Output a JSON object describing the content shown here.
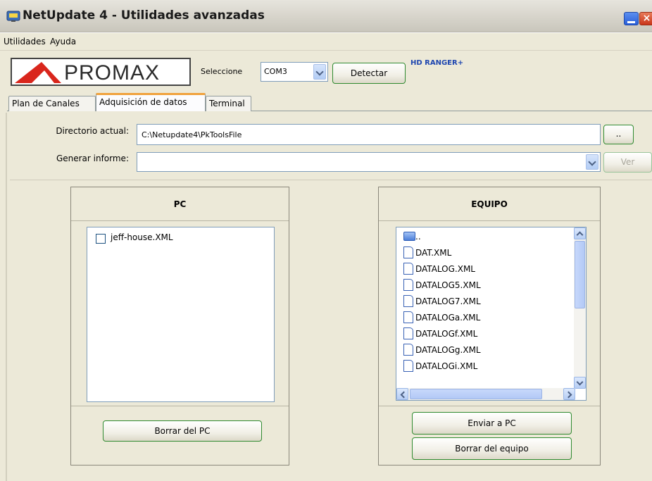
{
  "window": {
    "title": "NetUpdate 4 - Utilidades avanzadas",
    "close_glyph": "×"
  },
  "menu": {
    "items": [
      "Utilidades",
      "Ayuda"
    ]
  },
  "toolbar": {
    "logo_text": "PROMAX",
    "port_label": "Seleccione",
    "port_value": "COM3",
    "detect_label": "Detectar",
    "device_name": "HD RANGER+"
  },
  "tabs": [
    {
      "label": "Plan de Canales",
      "active": false
    },
    {
      "label": "Adquisición de datos",
      "active": true
    },
    {
      "label": "Terminal",
      "active": false
    }
  ],
  "form": {
    "directory_label": "Directorio actual:",
    "directory_value": "C:\\Netupdate4\\PkToolsFile",
    "browse_label": "..",
    "report_label": "Generar informe:",
    "report_value": "",
    "view_label": "Ver"
  },
  "pc_panel": {
    "title": "PC",
    "files": [
      {
        "name": "jeff-house.XML",
        "checked": false
      }
    ],
    "delete_label": "Borrar del PC"
  },
  "equipment_panel": {
    "title": "EQUIPO",
    "files": [
      "..",
      "DAT.XML",
      "DATALOG.XML",
      "DATALOG5.XML",
      "DATALOG7.XML",
      "DATALOGa.XML",
      "DATALOGf.XML",
      "DATALOGg.XML",
      "DATALOGi.XML"
    ],
    "send_label": "Enviar a PC",
    "delete_label": "Borrar del equipo"
  },
  "colors": {
    "accent_tab": "#f0a23c",
    "button_border": "#2f8a2f",
    "device_name": "#1f47b0",
    "logo_red": "#d9261c"
  }
}
